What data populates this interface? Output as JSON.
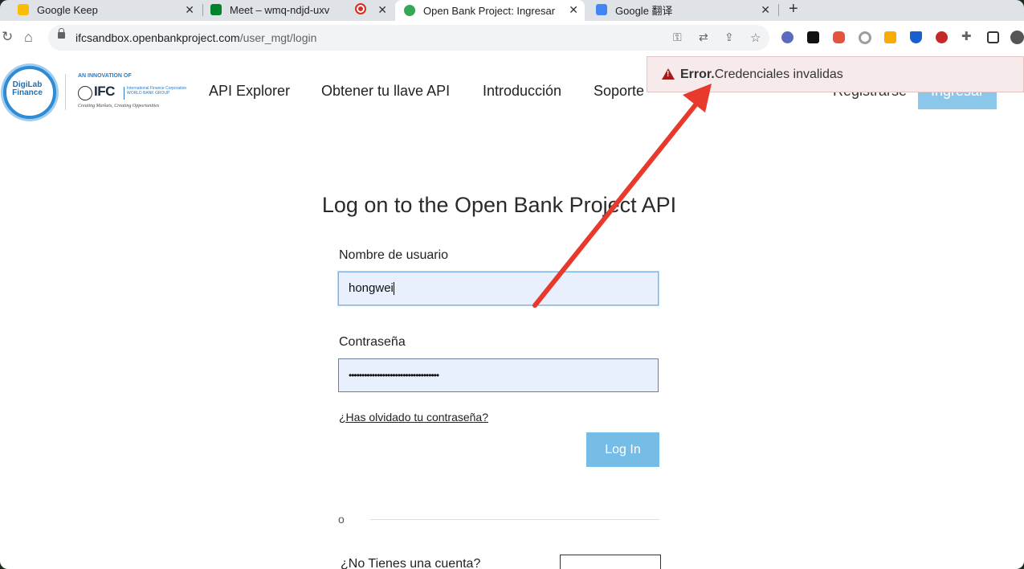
{
  "browser": {
    "tabs": [
      {
        "title": "Google Keep",
        "icon": "keep-icon",
        "color": "#fbbc04"
      },
      {
        "title": "Meet – wmq-ndjd-uxv",
        "icon": "meet-icon",
        "color": "#00832d"
      },
      {
        "title": "Open Bank Project: Ingresar",
        "icon": "obp-icon",
        "color": "#34a853"
      },
      {
        "title": "Google 翻译",
        "icon": "translate-icon",
        "color": "#4285f4"
      }
    ],
    "url_host": "ifcsandbox.openbankproject.com",
    "url_path": "/user_mgt/login"
  },
  "header": {
    "logo_text": "DigiLab Finance",
    "ifc_tagline_top": "AN INNOVATION OF",
    "ifc_name": "IFC",
    "ifc_full": "International Finance Corporation",
    "ifc_group": "WORLD BANK GROUP",
    "ifc_slogan": "Creating Markets, Creating Opportunities",
    "nav": [
      "API Explorer",
      "Obtener tu llave API",
      "Introducción",
      "Soporte"
    ],
    "register_label": "Registrarse",
    "login_label": "Ingresar"
  },
  "error": {
    "prefix": "Error.",
    "message": "Credenciales invalidas"
  },
  "form": {
    "title": "Log on to the Open Bank Project API",
    "username_label": "Nombre de usuario",
    "username_value": "hongwei",
    "password_label": "Contraseña",
    "password_value": "•••••••••••••••••••••••••••••••••••",
    "forgot_label": "¿Has olvidado tu contraseña?",
    "submit_label": "Log In",
    "or_label": "o",
    "no_account_label": "¿No Tienes una cuenta?"
  },
  "colors": {
    "accent": "#75bde7",
    "error": "#a51b1b",
    "annotation_arrow": "#e8392d"
  }
}
